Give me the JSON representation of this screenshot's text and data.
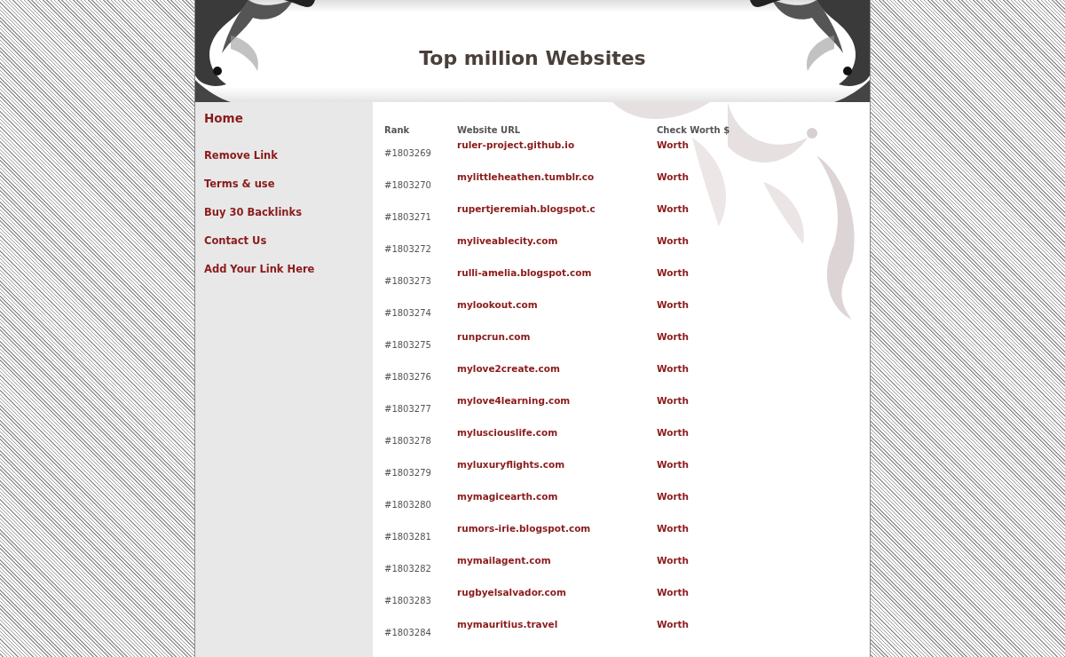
{
  "header": {
    "title": "Top million Websites"
  },
  "sidebar": {
    "items": [
      {
        "label": "Home",
        "kind": "home"
      },
      {
        "label": "Remove Link",
        "kind": "link"
      },
      {
        "label": "Terms & use",
        "kind": "link"
      },
      {
        "label": "Buy 30 Backlinks",
        "kind": "link"
      },
      {
        "label": "Contact Us",
        "kind": "link"
      },
      {
        "label": "Add Your Link Here",
        "kind": "link"
      }
    ]
  },
  "table": {
    "columns": [
      "Rank",
      "Website URL",
      "Check Worth $"
    ],
    "rows": [
      {
        "rank": "#1803269",
        "url": "ruler-project.github.io",
        "action": "Worth"
      },
      {
        "rank": "#1803270",
        "url": "mylittleheathen.tumblr.co",
        "action": "Worth"
      },
      {
        "rank": "#1803271",
        "url": "rupertjeremiah.blogspot.c",
        "action": "Worth"
      },
      {
        "rank": "#1803272",
        "url": "myliveablecity.com",
        "action": "Worth"
      },
      {
        "rank": "#1803273",
        "url": "rulli-amelia.blogspot.com",
        "action": "Worth"
      },
      {
        "rank": "#1803274",
        "url": "mylookout.com",
        "action": "Worth"
      },
      {
        "rank": "#1803275",
        "url": "runpcrun.com",
        "action": "Worth"
      },
      {
        "rank": "#1803276",
        "url": "mylove2create.com",
        "action": "Worth"
      },
      {
        "rank": "#1803277",
        "url": "mylove4learning.com",
        "action": "Worth"
      },
      {
        "rank": "#1803278",
        "url": "mylusciouslife.com",
        "action": "Worth"
      },
      {
        "rank": "#1803279",
        "url": "myluxuryflights.com",
        "action": "Worth"
      },
      {
        "rank": "#1803280",
        "url": "mymagicearth.com",
        "action": "Worth"
      },
      {
        "rank": "#1803281",
        "url": "rumors-irie.blogspot.com",
        "action": "Worth"
      },
      {
        "rank": "#1803282",
        "url": "mymailagent.com",
        "action": "Worth"
      },
      {
        "rank": "#1803283",
        "url": "rugbyelsalvador.com",
        "action": "Worth"
      },
      {
        "rank": "#1803284",
        "url": "mymauritius.travel",
        "action": "Worth"
      }
    ]
  }
}
